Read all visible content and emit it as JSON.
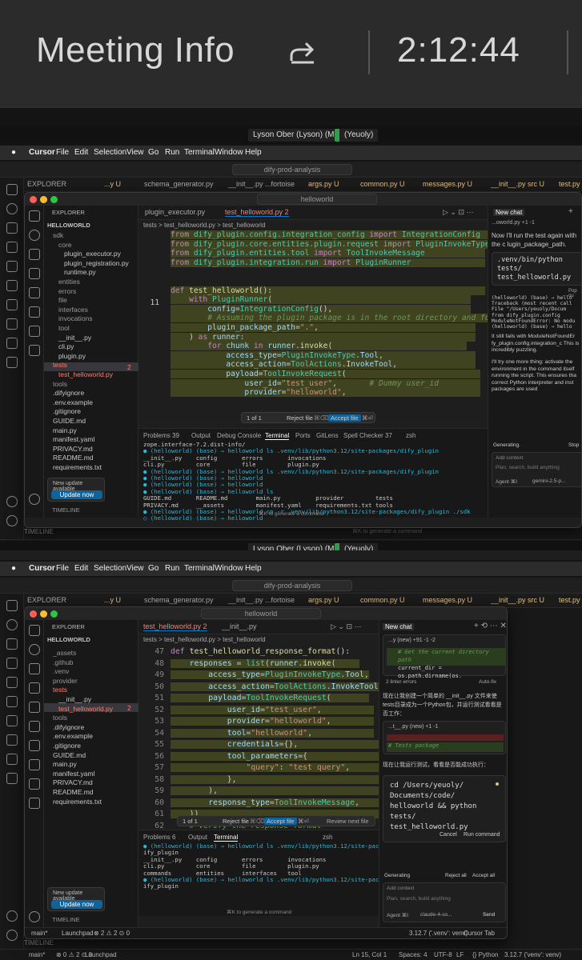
{
  "meeting": {
    "title": "Meeting Info",
    "timer": "2:12:44",
    "speaker_self": "Lyson Ober (Lyson)  (Me)",
    "speaker_other": "(Yeuoly)"
  },
  "macbar": {
    "apple": "",
    "app": "Cursor",
    "menus": [
      "File",
      "Edit",
      "Selection",
      "View",
      "Go",
      "Run",
      "Terminal",
      "Window",
      "Help"
    ]
  },
  "outer": {
    "search": "dify-prod-analysis",
    "tabs": [
      "...y U",
      "schema_generator.py",
      "__init__.py ...fortoise",
      "args.py U",
      "common.py U",
      "messages.py U",
      "__init__.py src U",
      "test.py"
    ],
    "explorer": "EXPLORER",
    "timeline": "TIMELINE",
    "status_left": "main*",
    "status_counts": "⊗ 0 ⚠ 2 ⊙ 0",
    "status_launchpad": "Launchpad",
    "status_cmdk": "⌘K to generate a command",
    "status_right": [
      "Ln 15, Col 1",
      "Spaces: 4",
      "UTF-8",
      "LF",
      "{} Python",
      "3.12.7 ('venv': venv)"
    ]
  },
  "shot1": {
    "search": "helloworld",
    "tabs": [
      "plugin_executor.py",
      "test_helloworld.py 2"
    ],
    "breadcrumb": "tests > test_helloworld.py > test_helloworld",
    "explorer": "EXPLORER",
    "project": "HELLOWORLD",
    "tree": [
      {
        "name": "sdk",
        "cls": "dim",
        "indent": 1
      },
      {
        "name": "core",
        "cls": "dim",
        "indent": 2
      },
      {
        "name": "plugin_executor.py",
        "cls": "",
        "indent": 3
      },
      {
        "name": "plugin_registration.py",
        "cls": "",
        "indent": 3
      },
      {
        "name": "runtime.py",
        "cls": "",
        "indent": 3
      },
      {
        "name": "entities",
        "cls": "dim",
        "indent": 2
      },
      {
        "name": "errors",
        "cls": "dim",
        "indent": 2
      },
      {
        "name": "file",
        "cls": "dim",
        "indent": 2
      },
      {
        "name": "interfaces",
        "cls": "dim",
        "indent": 2
      },
      {
        "name": "invocations",
        "cls": "dim",
        "indent": 2
      },
      {
        "name": "tool",
        "cls": "dim",
        "indent": 2
      },
      {
        "name": "__init__.py",
        "cls": "",
        "indent": 2
      },
      {
        "name": "cli.py",
        "cls": "",
        "indent": 2
      },
      {
        "name": "plugin.py",
        "cls": "",
        "indent": 2
      },
      {
        "name": "tests",
        "cls": "err",
        "indent": 1
      },
      {
        "name": "test_helloworld.py",
        "cls": "err",
        "indent": 2
      },
      {
        "name": "tools",
        "cls": "dim",
        "indent": 1
      },
      {
        "name": ".difyignore",
        "cls": "",
        "indent": 1
      },
      {
        "name": ".env.example",
        "cls": "",
        "indent": 1
      },
      {
        "name": ".gitignore",
        "cls": "",
        "indent": 1
      },
      {
        "name": "GUIDE.md",
        "cls": "",
        "indent": 1
      },
      {
        "name": "main.py",
        "cls": "",
        "indent": 1
      },
      {
        "name": "manifest.yaml",
        "cls": "",
        "indent": 1
      },
      {
        "name": "PRIVACY.md",
        "cls": "",
        "indent": 1
      },
      {
        "name": "README.md",
        "cls": "",
        "indent": 1
      },
      {
        "name": "requirements.txt",
        "cls": "",
        "indent": 1
      }
    ],
    "err_badge": "2",
    "current_line": "11",
    "diffbar": {
      "nav": "1 of 1",
      "reject": "Reject file",
      "reject_kbd": "⌘⌫",
      "accept": "Accept file",
      "accept_kbd": "⌘⏎"
    },
    "panel_tabs": [
      "Problems 39",
      "Output",
      "Debug Console",
      "Terminal",
      "Ports",
      "GitLens",
      "Spell Checker 37",
      "zsh"
    ],
    "terminal": [
      "zope.interface-7.2.dist-info/",
      "● (helloworld) (base) → helloworld ls .venv/lib/python3.12/site-packages/dify_plugin",
      "__init__.py    config       errors       invocations",
      "cli.py         core         file         plugin.py",
      "● (helloworld) (base) → helloworld ls .venv/lib/python3.12/site-packages/dify_plugin",
      "● (helloworld) (base) → helloworld",
      "● (helloworld) (base) → helloworld",
      "● (helloworld) (base) → helloworld ls",
      "GUIDE.md       README.md        main.py          provider         tests",
      "PRIVACY.md     __assets         manifest.yaml    requirements.txt tools",
      "● (helloworld) (base) → helloworld cp -r .venv/lib/python3.12/site-packages/dify_plugin ./sdk",
      "○ (helloworld) (base) → helloworld "
    ],
    "cmdk": "⌘K to generate a command",
    "toast_title": "New update available",
    "toast_button": "Update now",
    "timeline": "TIMELINE",
    "chat": {
      "title": "New chat",
      "file_chip": "...oworld.py +1 -1",
      "p1": "Now I'll run the test again with the c lugin_package_path.",
      "cmd": ".venv/bin/python tests/ test_helloworld.py",
      "popout": "Pop ou",
      "out": [
        "(helloworld) (base) → hello",
        "Traceback (most recent call",
        "  File \"/Users/yeuoly/Docum",
        "    from dify_plugin.config",
        "ModuleNotFoundError: No modu",
        "(helloworld) (base) → hello"
      ],
      "p2": "It still fails with ModuleNotFoundEr fy_plugin.config.integration_c This is incredibly puzzling.",
      "p3": "I'll try one more thing: activate the environment in the command itself running the script. This ensures tha correct Python interpreter and inst packages are used",
      "generating": "Generating.",
      "stop": "Stop",
      "add_context": "Add context",
      "placeholder": "Plan, search, build anything",
      "agent": "Agent ⌘I",
      "model": "gemini-2.5-p..."
    }
  },
  "shot2": {
    "search": "helloworld",
    "tabs": [
      "test_helloworld.py 2",
      "__init__.py"
    ],
    "breadcrumb": "tests > test_helloworld.py > test_helloworld",
    "explorer": "EXPLORER",
    "project": "HELLOWORLD",
    "tree": [
      {
        "name": "_assets",
        "cls": "dim",
        "indent": 1
      },
      {
        "name": ".github",
        "cls": "dim",
        "indent": 1
      },
      {
        "name": ".venv",
        "cls": "dim",
        "indent": 1
      },
      {
        "name": "provider",
        "cls": "dim",
        "indent": 1
      },
      {
        "name": "tests",
        "cls": "err",
        "indent": 1
      },
      {
        "name": "__init__.py",
        "cls": "",
        "indent": 2
      },
      {
        "name": "test_helloworld.py",
        "cls": "err",
        "indent": 2
      },
      {
        "name": "tools",
        "cls": "dim",
        "indent": 1
      },
      {
        "name": ".difyignore",
        "cls": "",
        "indent": 1
      },
      {
        "name": ".env.example",
        "cls": "",
        "indent": 1
      },
      {
        "name": ".gitignore",
        "cls": "",
        "indent": 1
      },
      {
        "name": "GUIDE.md",
        "cls": "",
        "indent": 1
      },
      {
        "name": "main.py",
        "cls": "",
        "indent": 1
      },
      {
        "name": "manifest.yaml",
        "cls": "",
        "indent": 1
      },
      {
        "name": "PRIVACY.md",
        "cls": "",
        "indent": 1
      },
      {
        "name": "README.md",
        "cls": "",
        "indent": 1
      },
      {
        "name": "requirements.txt",
        "cls": "",
        "indent": 1
      }
    ],
    "err_badge": "2",
    "line_numbers": [
      "47",
      "48",
      "49",
      "50",
      "51",
      "52",
      "53",
      "54",
      "55",
      "56",
      "57",
      "58",
      "59",
      "60",
      "61",
      "62"
    ],
    "diffbar": {
      "nav": "1 of 1",
      "reject": "Reject file",
      "reject_kbd": "⌘⌫",
      "accept": "Accept file",
      "accept_kbd": "⌘⏎",
      "review": "Review next file"
    },
    "panel_tabs": [
      "Problems 6",
      "Output",
      "Terminal",
      "zsh"
    ],
    "terminal": [
      "● (helloworld) (base) → helloworld ls .venv/lib/python3.12/site-packages/d",
      "ify_plugin",
      "__init__.py    config       errors       invocations",
      "cli.py         core         file         plugin.py",
      "commands       entities     interfaces   tool",
      "● (helloworld) (base) → helloworld ls .venv/lib/python3.12/site-packages/d",
      "ify_plugin"
    ],
    "cmdk": "⌘K to generate a command",
    "toast_title": "New update available",
    "toast_button": "Update now",
    "timeline": "TIMELINE",
    "status_left": "main*",
    "status_counts": "⊗ 2 ⚠ 2 ⊙ 0",
    "status_launchpad": "Launchpad",
    "status_right": [
      "3.12.7 ('.venv': venv)",
      "Cursor Tab"
    ],
    "chat": {
      "title": "New chat",
      "file_chip": "...y (new) +91 -1 -2",
      "code1a": "# Get the current directory path",
      "code1b": "current_dir = os.path.dirname(os.",
      "errors": "2 linter errors",
      "autofix": "Auto-fix",
      "p1": "现在让我创建一个简单的 __init__.py 文件来使 tests目录成为一个Python包，并运行测试看看是否工作：",
      "file_chip2": "...t__.py (new) +1 -1",
      "code2": "# Tests package",
      "p2": "现在让我运行测试，看看是否能成功执行：",
      "cmd": "cd /Users/yeuoly/ Documents/code/ helloworld && python tests/ test_helloworld.py",
      "cancel": "Cancel",
      "run": "Run command",
      "generating": "Generating",
      "reject_all": "Reject all",
      "accept_all": "Accept all",
      "add_context": "Add context",
      "placeholder": "Plan, search, build anything",
      "agent": "Agent ⌘I",
      "model": "claude-4-so...",
      "send": "Send"
    }
  }
}
